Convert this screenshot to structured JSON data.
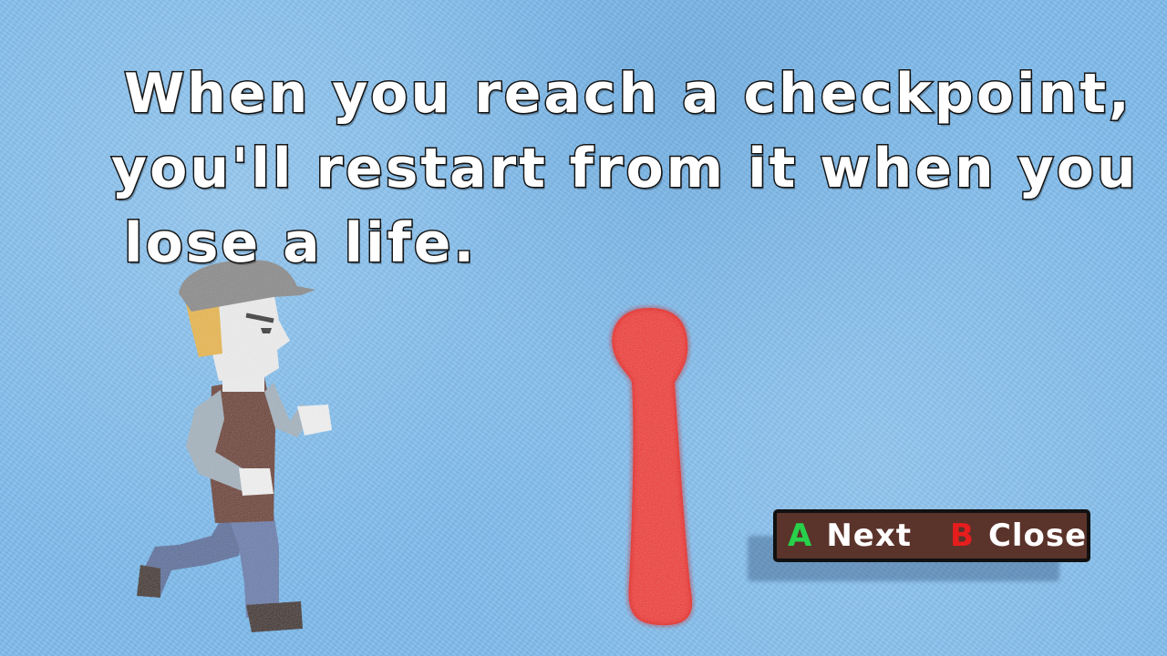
{
  "tutorial": {
    "lines": [
      "When you reach a checkpoint,",
      "you'll restart from it when you",
      "lose a life."
    ]
  },
  "prompt": {
    "next": {
      "key": "A",
      "label": "Next",
      "key_color": "#27d14a"
    },
    "close": {
      "key": "B",
      "label": "Close",
      "key_color": "#e61d1d"
    }
  },
  "colors": {
    "background": "#7fbbeb",
    "checkpoint": "#f0302c",
    "prompt_box": "#5a332a"
  }
}
